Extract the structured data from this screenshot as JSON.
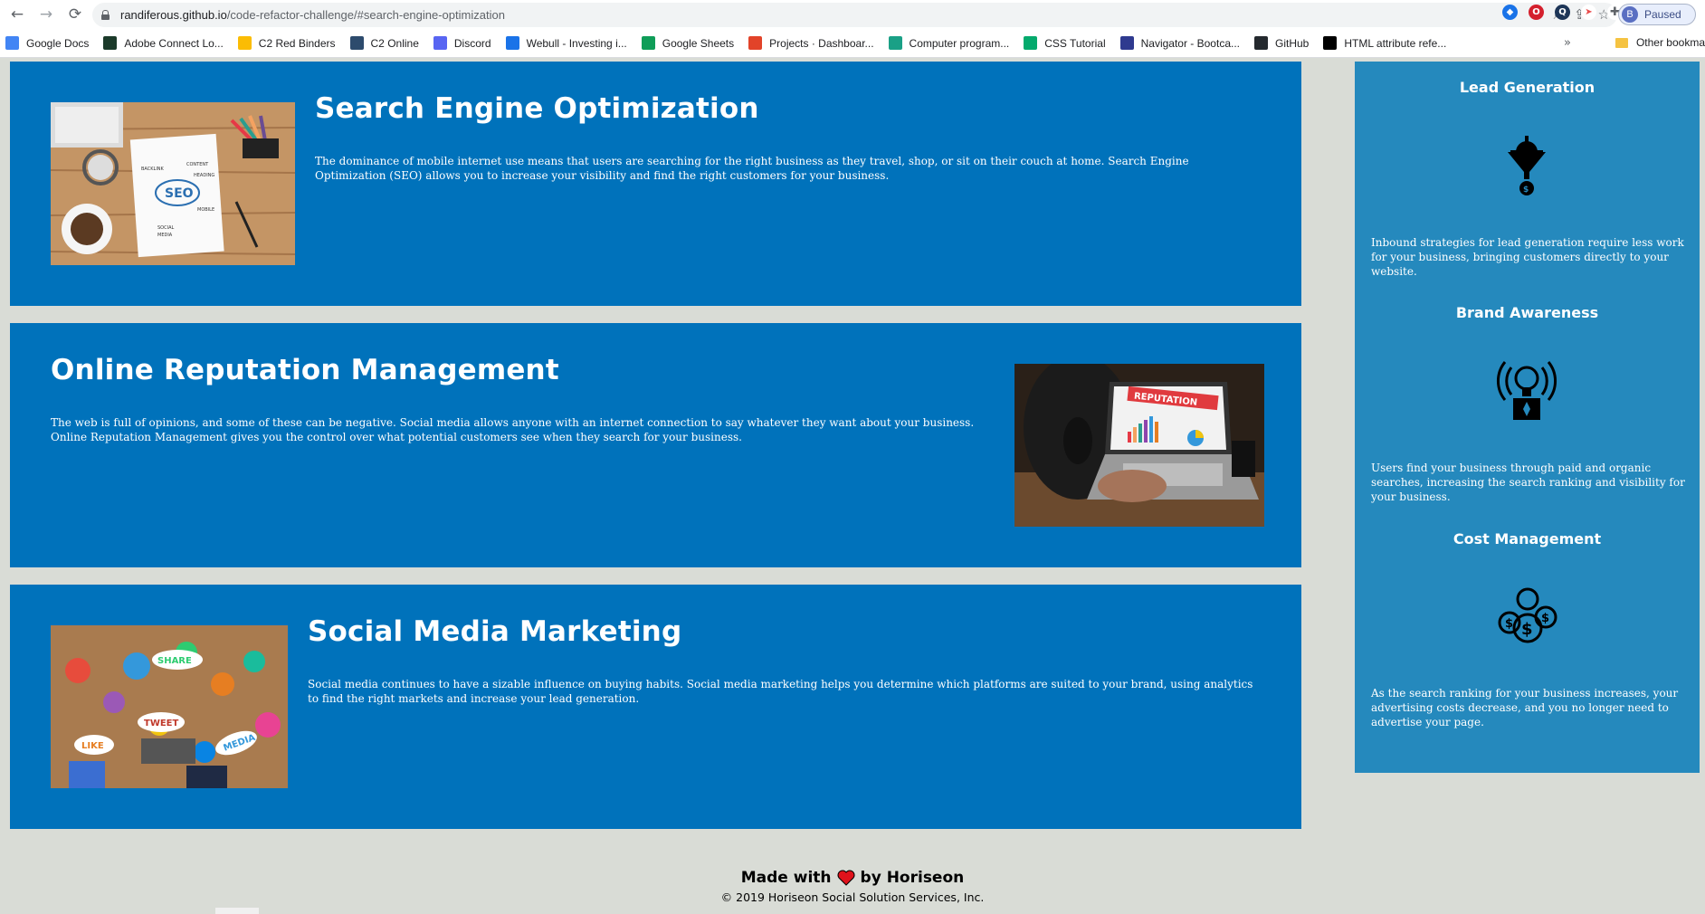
{
  "browser": {
    "url_host": "randiferous.github.io",
    "url_path": "/code-refactor-challenge/#search-engine-optimization",
    "profile_initial": "B",
    "profile_status": "Paused",
    "bookmarks": [
      {
        "label": "Google Docs",
        "icon": "google-docs-icon",
        "color": "#4285f4"
      },
      {
        "label": "Adobe Connect Lo...",
        "icon": "adobe-connect-icon",
        "color": "#1b3a2a"
      },
      {
        "label": "C2 Red Binders",
        "icon": "google-drive-icon",
        "color": "#fbbc04"
      },
      {
        "label": "C2 Online",
        "icon": "c2-icon",
        "color": "#2d4b6d"
      },
      {
        "label": "Discord",
        "icon": "discord-icon",
        "color": "#5865f2"
      },
      {
        "label": "Webull - Investing i...",
        "icon": "webull-icon",
        "color": "#1a73e8"
      },
      {
        "label": "Google Sheets",
        "icon": "google-sheets-icon",
        "color": "#0f9d58"
      },
      {
        "label": "Projects · Dashboar...",
        "icon": "gitlab-icon",
        "color": "#e24329"
      },
      {
        "label": "Computer program...",
        "icon": "codecademy-icon",
        "color": "#1aa086"
      },
      {
        "label": "CSS Tutorial",
        "icon": "w3schools-icon",
        "color": "#04aa6d"
      },
      {
        "label": "Navigator - Bootca...",
        "icon": "navigator-icon",
        "color": "#2f3a8f"
      },
      {
        "label": "GitHub",
        "icon": "github-icon",
        "color": "#24292e"
      },
      {
        "label": "HTML attribute refe...",
        "icon": "mdn-icon",
        "color": "#000000"
      }
    ],
    "bookmarks_more": "»",
    "other_bookmarks": "Other bookma"
  },
  "cards": [
    {
      "title": "Search Engine Optimization",
      "text": "The dominance of mobile internet use means that users are searching for the right business as they travel, shop, or sit on their couch at home. Search Engine Optimization (SEO) allows you to increase your visibility and find the right customers for your business.",
      "image": "seo-notebook-image"
    },
    {
      "title": "Online Reputation Management",
      "text": "The web is full of opinions, and some of these can be negative. Social media allows anyone with an internet connection to say whatever they want about your business. Online Reputation Management gives you the control over what potential customers see when they search for your business.",
      "image": "reputation-laptop-image",
      "image_sign": "REPUTATION"
    },
    {
      "title": "Social Media Marketing",
      "text": "Social media continues to have a sizable influence on buying habits. Social media marketing helps you determine which platforms are suited to your brand, using analytics to find the right markets and increase your lead generation.",
      "image": "social-media-table-image",
      "image_words": [
        "SHARE",
        "TWEET",
        "LIKE",
        "MEDIA"
      ]
    }
  ],
  "benefits": [
    {
      "title": "Lead Generation",
      "icon": "lead-generation-icon",
      "text": "Inbound strategies for lead generation require less work for your business, bringing customers directly to your website."
    },
    {
      "title": "Brand Awareness",
      "icon": "brand-awareness-icon",
      "text": "Users find your business through paid and organic searches, increasing the search ranking and visibility for your business."
    },
    {
      "title": "Cost Management",
      "icon": "cost-management-icon",
      "text": "As the search ranking for your business increases, your advertising costs decrease, and you no longer need to advertise your page."
    }
  ],
  "footer": {
    "made_with": "Made with",
    "by": "by Horiseon",
    "copyright": "© 2019 Horiseon Social Solution Services, Inc."
  },
  "colors": {
    "card_bg": "#0072bb",
    "benefits_bg": "#2589bd",
    "page_bg": "#d9dcd6",
    "heart": "#e0121b"
  }
}
